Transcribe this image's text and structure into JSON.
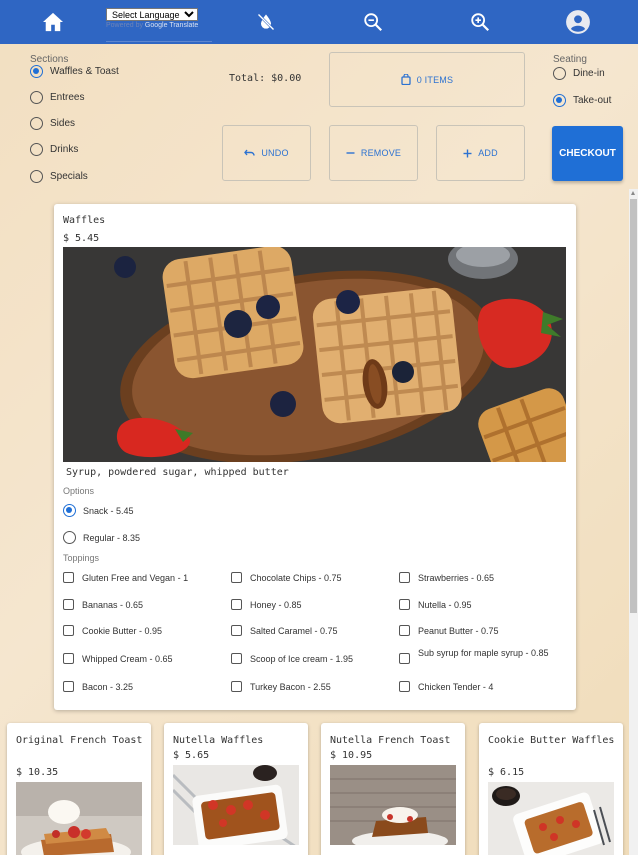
{
  "header": {
    "language_select": "Select Language",
    "powered_by": "Powered by",
    "translate": "Google Translate",
    "icons": [
      "home-icon",
      "invert-colors-off-icon",
      "zoom-out-icon",
      "zoom-in-icon",
      "account-circle-icon"
    ]
  },
  "sections": {
    "label": "Sections",
    "items": [
      {
        "label": "Waffles & Toast",
        "selected": true
      },
      {
        "label": "Entrees",
        "selected": false
      },
      {
        "label": "Sides",
        "selected": false
      },
      {
        "label": "Drinks",
        "selected": false
      },
      {
        "label": "Specials",
        "selected": false
      }
    ]
  },
  "order": {
    "total": "Total: $0.00",
    "items_label": "0 ITEMS",
    "undo_label": "UNDO",
    "remove_label": "REMOVE",
    "add_label": "ADD",
    "checkout_label": "CHECKOUT"
  },
  "seating": {
    "label": "Seating",
    "options": [
      {
        "label": "Dine-in",
        "selected": false
      },
      {
        "label": "Take-out",
        "selected": true
      }
    ]
  },
  "item": {
    "title": "Waffles",
    "price": "$ 5.45",
    "description": "Syrup, powdered sugar, whipped butter",
    "options_label": "Options",
    "options": [
      {
        "label": "Snack - 5.45",
        "selected": true
      },
      {
        "label": "Regular - 8.35",
        "selected": false
      }
    ],
    "toppings_label": "Toppings",
    "toppings": [
      "Gluten Free and Vegan - 1",
      "Chocolate Chips - 0.75",
      "Strawberries - 0.65",
      "Bananas - 0.65",
      "Honey - 0.85",
      "Nutella - 0.95",
      "Cookie Butter - 0.95",
      "Salted Caramel - 0.75",
      "Peanut Butter - 0.75",
      "Whipped Cream - 0.65",
      "Scoop of Ice cream - 1.95",
      "Sub syrup for maple syrup - 0.85",
      "Bacon - 3.25",
      "Turkey Bacon - 2.55",
      "Chicken Tender - 4"
    ]
  },
  "menu_items": [
    {
      "title": "Original French Toast",
      "price": "$ 10.35"
    },
    {
      "title": "Nutella Waffles",
      "price": "$ 5.65"
    },
    {
      "title": "Nutella French Toast",
      "price": "$ 10.95"
    },
    {
      "title": "Cookie Butter Waffles",
      "price": "$ 6.15"
    }
  ],
  "colors": {
    "header": "#2f66c3",
    "accent": "#1f6fd6"
  }
}
